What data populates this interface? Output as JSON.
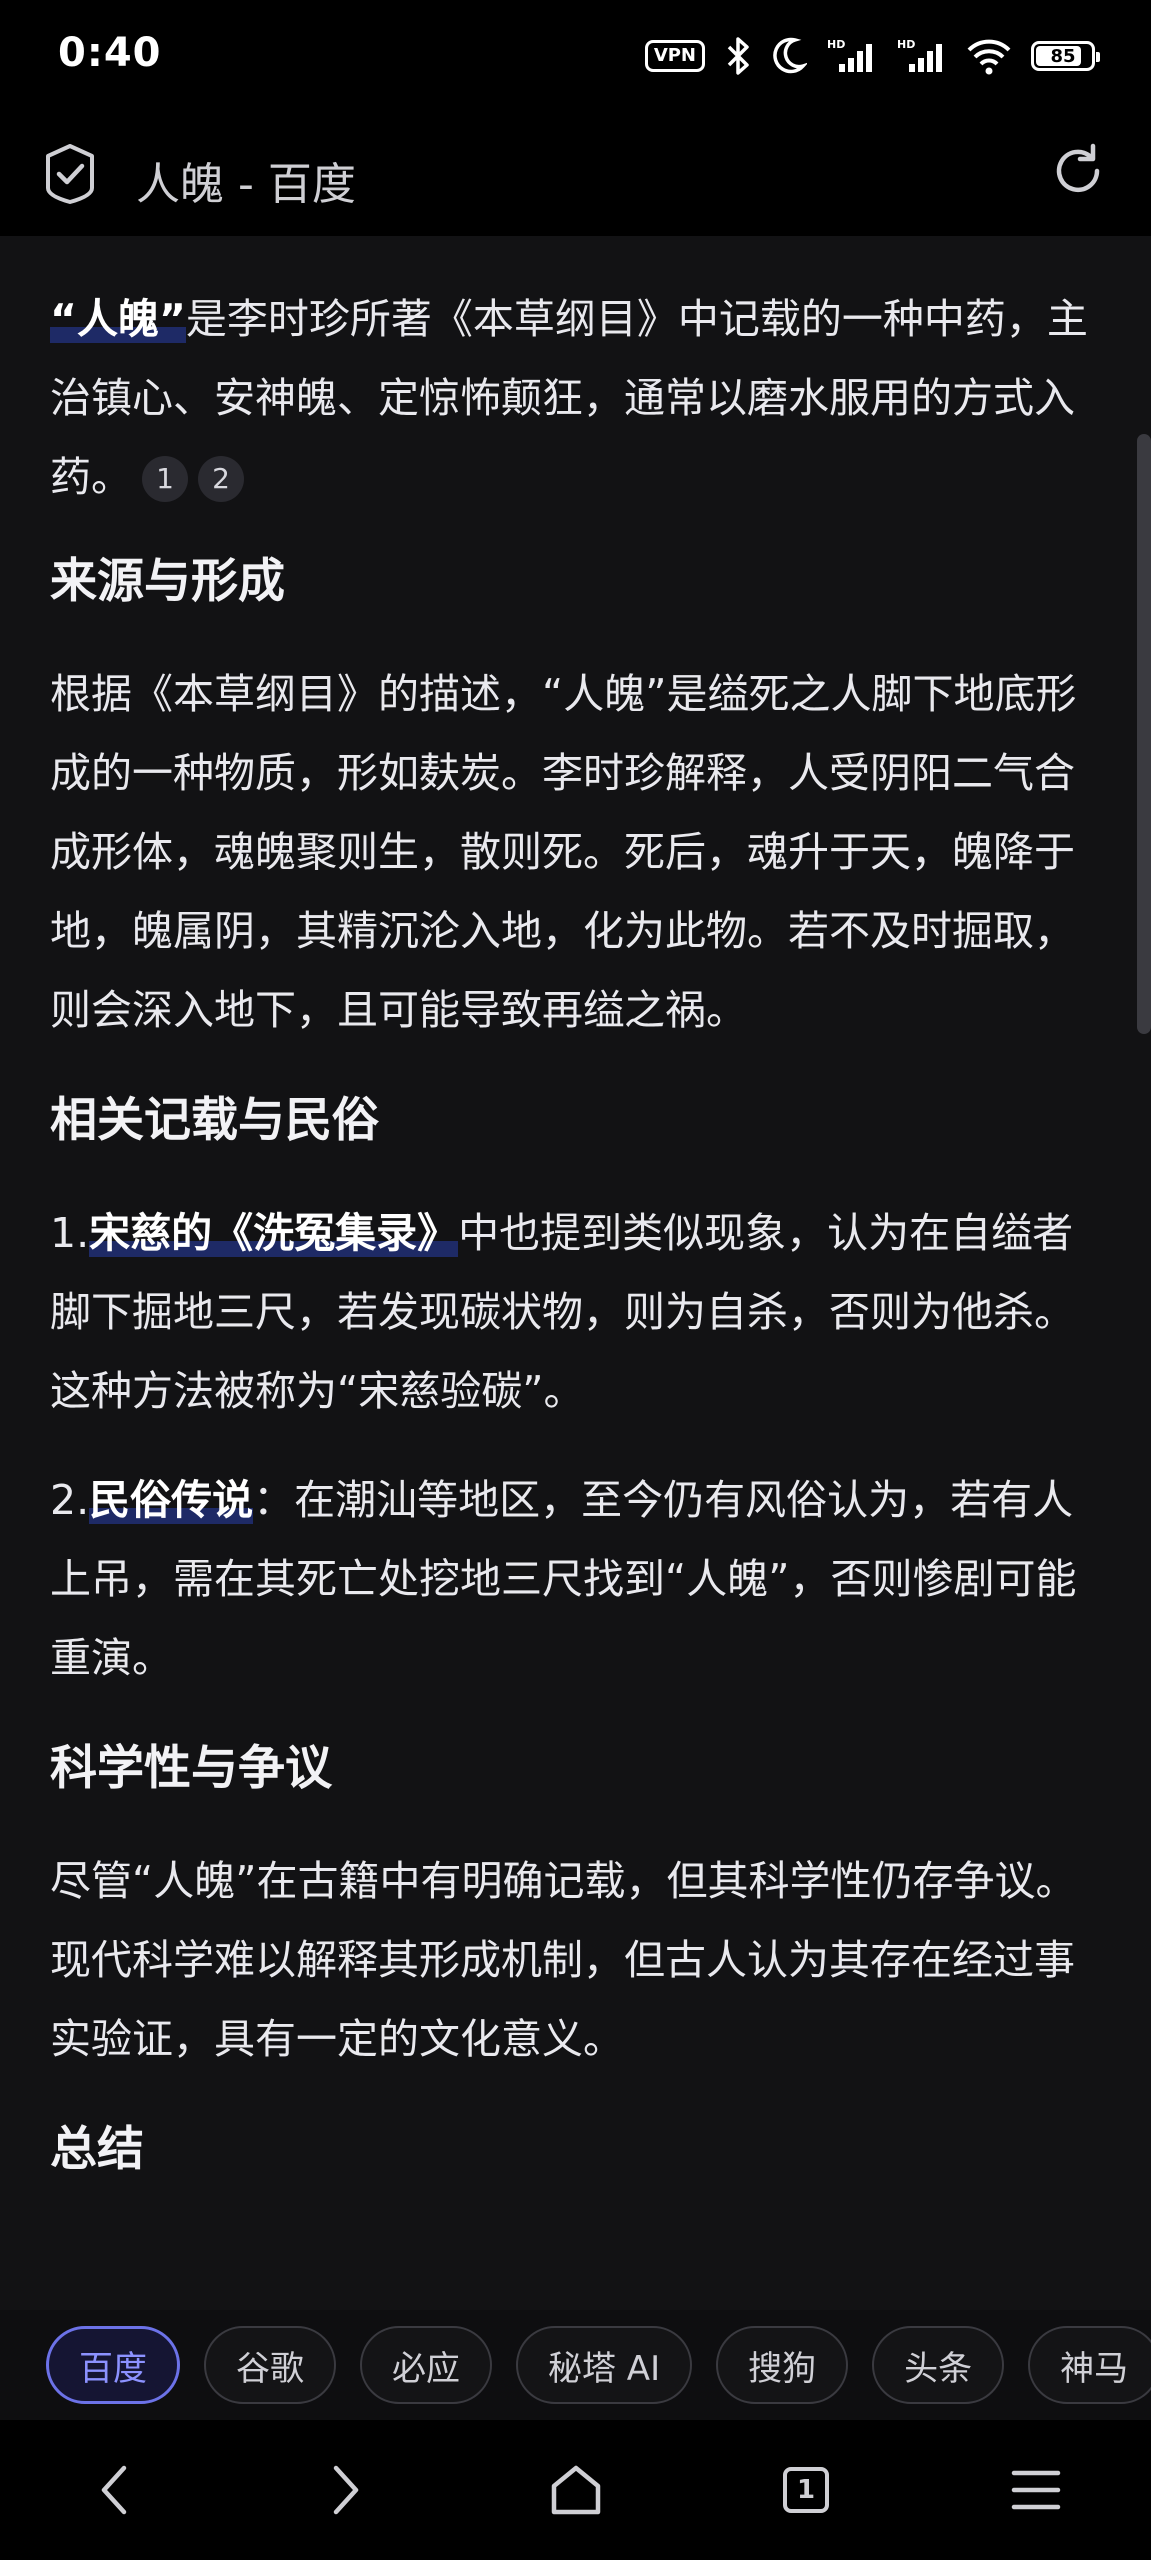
{
  "status_bar": {
    "time": "0:40",
    "vpn": "VPN",
    "battery": "85",
    "battery_percent": 85
  },
  "title_bar": {
    "title": "人魄 - 百度",
    "shield_icon": "shield-check-icon",
    "reload_icon": "reload-icon"
  },
  "article": {
    "intro": {
      "term": "“人魄”",
      "text": "是李时珍所著《本草纲目》中记载的一种中药，主治镇心、安神魄、定惊怖颠狂，通常以磨水服用的方式入药。",
      "refs": [
        "1",
        "2"
      ]
    },
    "section1": {
      "heading": "来源与形成",
      "body": "根据《本草纲目》的描述，“人魄”是缢死之人脚下地底形成的一种物质，形如麸炭。李时珍解释，人受阴阳二气合成形体，魂魄聚则生，散则死。死后，魂升于天，魄降于地，魄属阴，其精沉沦入地，化为此物。若不及时掘取，则会深入地下，且可能导致再缢之祸。"
    },
    "section2": {
      "heading": "相关记载与民俗",
      "item1_num": "1.",
      "item1_bold": "宋慈的《洗冤集录》",
      "item1_text": "中也提到类似现象，认为在自缢者脚下掘地三尺，若发现碳状物，则为自杀，否则为他杀。这种方法被称为“宋慈验碳”。",
      "item2_num": "2.",
      "item2_bold": "民俗传说",
      "item2_text": "：在潮汕等地区，至今仍有风俗认为，若有人上吊，需在其死亡处挖地三尺找到“人魄”，否则惨剧可能重演。"
    },
    "section3": {
      "heading": "科学性与争议",
      "body": "尽管“人魄”在古籍中有明确记载，但其科学性仍存争议。现代科学难以解释其形成机制，但古人认为其存在经过事实验证，具有一定的文化意义。"
    },
    "section4": {
      "heading": "总结"
    }
  },
  "engines": [
    "百度",
    "谷歌",
    "必应",
    "秘塔 AI",
    "搜狗",
    "头条",
    "神马"
  ],
  "nav": {
    "back_icon": "back-arrow-icon",
    "forward_icon": "forward-arrow-icon",
    "home_icon": "home-icon",
    "tabs_count": "1",
    "menu_icon": "menu-icon"
  },
  "colors": {
    "content_bg": "#121214",
    "highlight": "#1e2a66",
    "active_chip": "#6c72e8"
  }
}
